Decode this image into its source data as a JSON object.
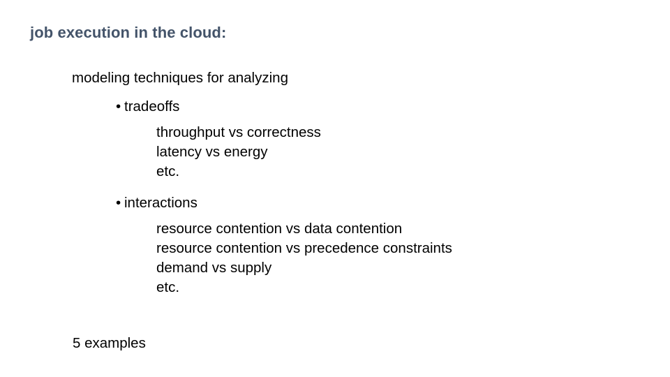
{
  "slide": {
    "background_color": "#ffffff",
    "title": {
      "text": "job execution in the cloud:",
      "color": "#44546a"
    },
    "lead_line": "modeling techniques for analyzing",
    "bullet_glyph": "•",
    "bullets": [
      {
        "label": "tradeoffs",
        "sub_items": [
          "throughput vs correctness",
          "latency vs energy",
          "etc."
        ]
      },
      {
        "label": "interactions",
        "sub_items": [
          "resource contention vs data contention",
          "resource contention vs precedence constraints",
          "demand vs supply",
          "etc."
        ]
      }
    ],
    "footer_note": "5 examples"
  }
}
